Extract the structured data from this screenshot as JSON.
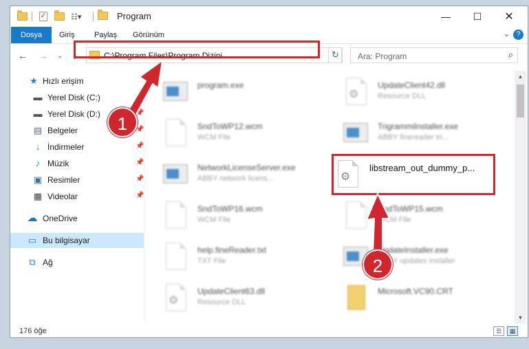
{
  "window": {
    "title": "Program"
  },
  "ribbon": {
    "tabs": [
      {
        "label": "Dosya",
        "active": true
      },
      {
        "label": "Giriş"
      },
      {
        "label": "Paylaş"
      },
      {
        "label": "Görünüm"
      }
    ],
    "help_label": "?"
  },
  "address": {
    "path": "C:\\Program Files\\Program Dizini"
  },
  "search": {
    "placeholder": "Ara: Program"
  },
  "sidebar": {
    "items": [
      {
        "label": "Hızlı erişim",
        "icon": "star-icon"
      },
      {
        "label": "Yerel Disk (C:)",
        "icon": "drive-icon",
        "pinned": true
      },
      {
        "label": "Yerel Disk (D:)",
        "icon": "drive-icon",
        "pinned": true
      },
      {
        "label": "Belgeler",
        "icon": "documents-icon",
        "pinned": true
      },
      {
        "label": "İndirmeler",
        "icon": "download-icon",
        "pinned": true
      },
      {
        "label": "Müzik",
        "icon": "music-icon",
        "pinned": true
      },
      {
        "label": "Resimler",
        "icon": "pictures-icon",
        "pinned": true
      },
      {
        "label": "Videolar",
        "icon": "video-icon",
        "pinned": true
      },
      {
        "label": "OneDrive",
        "icon": "cloud-icon"
      },
      {
        "label": "Bu bilgisayar",
        "icon": "computer-icon",
        "selected": true
      },
      {
        "label": "Ağ",
        "icon": "network-icon"
      }
    ]
  },
  "files": {
    "left": [
      {
        "name": "program.exe",
        "type": "",
        "icon": "app-icon"
      },
      {
        "name": "SndToWP12.wcm",
        "type": "WCM File",
        "icon": "document-icon"
      },
      {
        "name": "NetworkLicenseServer.exe",
        "type": "ABBY network licens...",
        "icon": "app-icon"
      },
      {
        "name": "SndToWP16.wcm",
        "type": "WCM File",
        "icon": "document-icon"
      },
      {
        "name": "help.fineReader.txt",
        "type": "TXT File",
        "icon": "document-icon"
      },
      {
        "name": "UpdateClient63.dll",
        "type": "Resource DLL",
        "icon": "settings-file-icon"
      }
    ],
    "right": [
      {
        "name": "UpdateClient42.dll",
        "type": "Resource DLL",
        "icon": "settings-file-icon"
      },
      {
        "name": "Trigrammilnstaller.exe",
        "type": "ABBY finereader tri...",
        "icon": "app-icon"
      },
      {
        "name": "libstream_out_dummy_p...",
        "type": "",
        "icon": "settings-file-icon",
        "highlight": true
      },
      {
        "name": "SndToWP15.wcm",
        "type": "WCM File",
        "icon": "document-icon"
      },
      {
        "name": "UpdateInstaller.exe",
        "type": "ABBY updates installer",
        "icon": "app-icon"
      },
      {
        "name": "Microsoft.VC90.CRT",
        "type": "",
        "icon": "folder-icon"
      }
    ]
  },
  "status": {
    "item_count": "176 öğe"
  },
  "annotations": {
    "badge1": "1",
    "badge2": "2",
    "color": "#d0272f"
  }
}
